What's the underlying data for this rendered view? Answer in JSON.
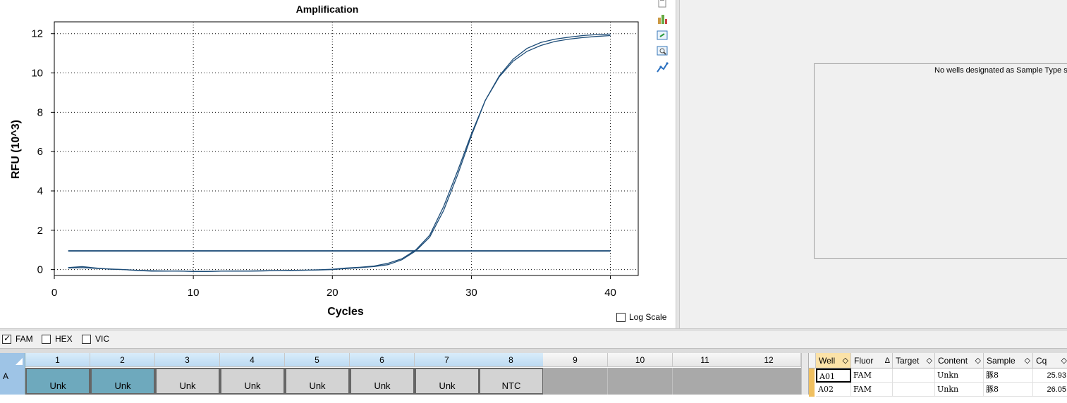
{
  "colors": {
    "curve": "#1f4e79",
    "well_filled": "#6ea9bd",
    "well_unfilled": "#d3d3d3",
    "well_empty": "#a9a9a9"
  },
  "chart_data": {
    "type": "line",
    "title": "Amplification",
    "xlabel": "Cycles",
    "ylabel": "RFU (10^3)",
    "xlim": [
      0,
      42
    ],
    "ylim": [
      -0.3,
      12.6
    ],
    "xticks": [
      0,
      10,
      20,
      30,
      40
    ],
    "yticks": [
      0,
      2,
      4,
      6,
      8,
      10,
      12
    ],
    "grid": true,
    "threshold": 0.95,
    "series": [
      {
        "x": [
          1,
          2,
          3,
          4,
          5,
          6,
          7,
          8,
          9,
          10,
          11,
          12,
          13,
          14,
          15,
          16,
          17,
          18,
          19,
          20,
          21,
          22,
          23,
          24,
          25,
          26,
          27,
          28,
          29,
          30,
          31,
          32,
          33,
          34,
          35,
          36,
          37,
          38,
          39,
          40
        ],
        "values": [
          0.1,
          0.15,
          0.08,
          0.02,
          0.0,
          -0.05,
          -0.08,
          -0.08,
          -0.07,
          -0.1,
          -0.1,
          -0.08,
          -0.08,
          -0.08,
          -0.07,
          -0.05,
          -0.05,
          -0.03,
          -0.01,
          0.02,
          0.08,
          0.12,
          0.18,
          0.32,
          0.55,
          1.0,
          1.75,
          3.2,
          5.0,
          6.9,
          8.6,
          9.8,
          10.6,
          11.1,
          11.4,
          11.6,
          11.72,
          11.8,
          11.86,
          11.9
        ]
      },
      {
        "x": [
          1,
          2,
          3,
          4,
          5,
          6,
          7,
          8,
          9,
          10,
          11,
          12,
          13,
          14,
          15,
          16,
          17,
          18,
          19,
          20,
          21,
          22,
          23,
          24,
          25,
          26,
          27,
          28,
          29,
          30,
          31,
          32,
          33,
          34,
          35,
          36,
          37,
          38,
          39,
          40
        ],
        "values": [
          0.08,
          0.1,
          0.06,
          0.03,
          0.0,
          -0.04,
          -0.06,
          -0.07,
          -0.08,
          -0.09,
          -0.09,
          -0.08,
          -0.07,
          -0.07,
          -0.06,
          -0.05,
          -0.04,
          -0.03,
          -0.02,
          0.0,
          0.05,
          0.1,
          0.15,
          0.25,
          0.5,
          0.95,
          1.65,
          3.0,
          4.8,
          6.8,
          8.6,
          9.85,
          10.7,
          11.25,
          11.55,
          11.72,
          11.82,
          11.9,
          11.95,
          11.98
        ]
      }
    ]
  },
  "toolbar": {
    "icons": [
      "copy-icon",
      "export-icon",
      "refresh-icon",
      "zoom-icon",
      "chart-settings-icon"
    ]
  },
  "log_scale": {
    "label": "Log Scale",
    "checked": false
  },
  "info_message": "No wells designated as Sample Type sta",
  "fluors": [
    {
      "label": "FAM",
      "checked": true
    },
    {
      "label": "HEX",
      "checked": false
    },
    {
      "label": "VIC",
      "checked": false
    }
  ],
  "plate": {
    "columns": [
      "1",
      "2",
      "3",
      "4",
      "5",
      "6",
      "7",
      "8",
      "9",
      "10",
      "11",
      "12"
    ],
    "row_label": "A",
    "wells": [
      "Unk",
      "Unk",
      "Unk",
      "Unk",
      "Unk",
      "Unk",
      "Unk",
      "NTC",
      "",
      "",
      "",
      ""
    ]
  },
  "table": {
    "headers": [
      "Well",
      "Fluor",
      "Target",
      "Content",
      "Sample",
      "Cq"
    ],
    "rows": [
      [
        "A01",
        "FAM",
        "",
        "Unkn",
        "豚8",
        "25.93"
      ],
      [
        "A02",
        "FAM",
        "",
        "Unkn",
        "豚8",
        "26.05"
      ]
    ]
  }
}
